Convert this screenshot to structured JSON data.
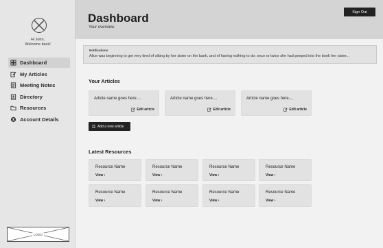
{
  "sidebar": {
    "greeting_line1": "Hi John,",
    "greeting_line2": "Welcome back!",
    "items": [
      {
        "label": "Dashboard",
        "icon": "dashboard-icon",
        "active": true
      },
      {
        "label": "My Articles",
        "icon": "edit-icon"
      },
      {
        "label": "Meeting Notes",
        "icon": "notes-icon"
      },
      {
        "label": "Directory",
        "icon": "directory-icon"
      },
      {
        "label": "Resources",
        "icon": "folder-icon"
      },
      {
        "label": "Account Details",
        "icon": "user-icon"
      }
    ],
    "logo_text": "LOGO"
  },
  "header": {
    "title": "Dashboard",
    "subtitle": "Your overview",
    "signout_label": "Sign Out"
  },
  "notifications": {
    "title": "Notifications",
    "message": "Alice was beginning to get very tired of sitting by her sister on the bank, and of having nothing to do: once or twice she had peeped into the book her sister..."
  },
  "articles": {
    "title": "Your Articles",
    "items": [
      {
        "name": "Article name goes here....",
        "edit_label": "Edit article"
      },
      {
        "name": "Article name goes here....",
        "edit_label": "Edit article"
      },
      {
        "name": "Article name goes here....",
        "edit_label": "Edit article"
      }
    ],
    "add_label": "Add a new article"
  },
  "resources": {
    "title": "Latest Resources",
    "items": [
      {
        "name": "Resource Name",
        "view_label": "View ›"
      },
      {
        "name": "Resource Name",
        "view_label": "View ›"
      },
      {
        "name": "Resource Name",
        "view_label": "View ›"
      },
      {
        "name": "Resource Name",
        "view_label": "View ›"
      },
      {
        "name": "Resource Name",
        "view_label": "View ›"
      },
      {
        "name": "Resource Name",
        "view_label": "View ›"
      },
      {
        "name": "Resource Name",
        "view_label": "View ›"
      },
      {
        "name": "Resource Name",
        "view_label": "View ›"
      }
    ]
  },
  "colors": {
    "dark_button": "#222222",
    "header_bg": "#d4d4d4",
    "sidebar_bg": "#e6e6e6",
    "card_bg": "#e2e2e2"
  }
}
